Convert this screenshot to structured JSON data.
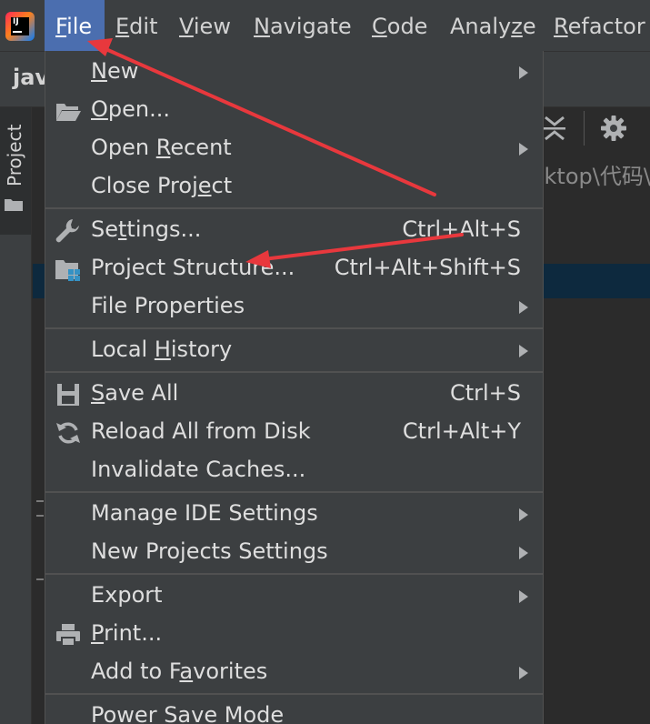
{
  "menubar": {
    "items": [
      {
        "label": "File",
        "mnemonic": "F",
        "rest": "ile"
      },
      {
        "label": "Edit",
        "mnemonic": "E",
        "rest": "dit"
      },
      {
        "label": "View",
        "mnemonic": "V",
        "rest": "iew"
      },
      {
        "label": "Navigate",
        "mnemonic": "N",
        "rest": "avigate"
      },
      {
        "label": "Code",
        "mnemonic": "C",
        "rest": "ode"
      },
      {
        "label": "Analyze",
        "pre": "Analy",
        "mnemonic": "z",
        "rest": "e"
      },
      {
        "label": "Refactor",
        "mnemonic": "R",
        "rest": "efactor"
      }
    ],
    "active": "File"
  },
  "toolbar": {
    "crumb": "jav"
  },
  "sidebar": {
    "tab_label": "Project"
  },
  "editor": {
    "path_fragment": "sktop\\代码\\"
  },
  "file_menu": {
    "items": [
      {
        "pre": "",
        "mn": "N",
        "post": "ew",
        "shortcut": "",
        "submenu": true,
        "icon": ""
      },
      {
        "pre": "",
        "mn": "O",
        "post": "pen...",
        "shortcut": "",
        "submenu": false,
        "icon": "folder-open-icon"
      },
      {
        "pre": "Open ",
        "mn": "R",
        "post": "ecent",
        "shortcut": "",
        "submenu": true,
        "icon": ""
      },
      {
        "pre": "Close Proj",
        "mn": "e",
        "post": "ct",
        "shortcut": "",
        "submenu": false,
        "icon": ""
      },
      {
        "pre": "Se",
        "mn": "t",
        "post": "tings...",
        "shortcut": "Ctrl+Alt+S",
        "submenu": false,
        "icon": "wrench-icon"
      },
      {
        "pre": "Project Structure...",
        "mn": "",
        "post": "",
        "shortcut": "Ctrl+Alt+Shift+S",
        "submenu": false,
        "icon": "project-structure-icon"
      },
      {
        "pre": "File Properties",
        "mn": "",
        "post": "",
        "shortcut": "",
        "submenu": true,
        "icon": ""
      },
      {
        "pre": "Local ",
        "mn": "H",
        "post": "istory",
        "shortcut": "",
        "submenu": true,
        "icon": ""
      },
      {
        "pre": "",
        "mn": "S",
        "post": "ave All",
        "shortcut": "Ctrl+S",
        "submenu": false,
        "icon": "save-icon"
      },
      {
        "pre": "Reload All from Disk",
        "mn": "",
        "post": "",
        "shortcut": "Ctrl+Alt+Y",
        "submenu": false,
        "icon": "reload-icon"
      },
      {
        "pre": "Invalidate Caches...",
        "mn": "",
        "post": "",
        "shortcut": "",
        "submenu": false,
        "icon": ""
      },
      {
        "pre": "Manage IDE Settings",
        "mn": "",
        "post": "",
        "shortcut": "",
        "submenu": true,
        "icon": ""
      },
      {
        "pre": "New Projects Settings",
        "mn": "",
        "post": "",
        "shortcut": "",
        "submenu": true,
        "icon": ""
      },
      {
        "pre": "Export",
        "mn": "",
        "post": "",
        "shortcut": "",
        "submenu": true,
        "icon": ""
      },
      {
        "pre": "",
        "mn": "P",
        "post": "rint...",
        "shortcut": "",
        "submenu": false,
        "icon": "print-icon"
      },
      {
        "pre": "Add to F",
        "mn": "a",
        "post": "vorites",
        "shortcut": "",
        "submenu": true,
        "icon": ""
      },
      {
        "pre": "Power Save Mode",
        "mn": "",
        "post": "",
        "shortcut": "",
        "submenu": false,
        "icon": ""
      }
    ]
  },
  "colors": {
    "menubar_bg": "#3c3f41",
    "active_menu_bg": "#4b6eaf",
    "dropdown_bg": "#3c3f41",
    "selection_row": "#0d293e",
    "annotation_arrow": "#e8383d"
  }
}
